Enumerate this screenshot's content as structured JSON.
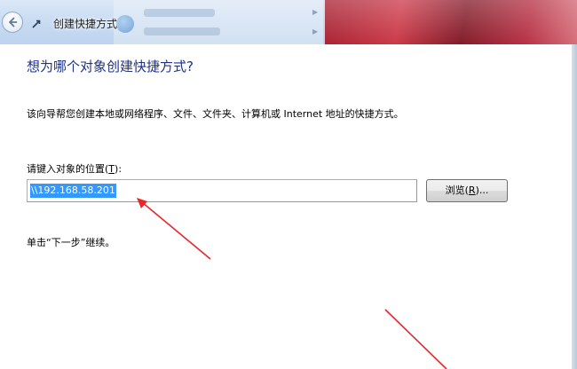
{
  "window": {
    "title": "创建快捷方式"
  },
  "wizard": {
    "heading": "想为哪个对象创建快捷方式?",
    "description": "该向导帮您创建本地或网络程序、文件、文件夹、计算机或 Internet 地址的快捷方式。",
    "location_label_prefix": "请键入对象的位置(",
    "location_label_accesskey": "T",
    "location_label_suffix": "):",
    "location_value": "\\\\192.168.58.201",
    "browse_label_prefix": "浏览(",
    "browse_label_accesskey": "R",
    "browse_label_suffix": ")...",
    "continue_text": "单击“下一步”继续。"
  },
  "icons": {
    "back": "back-arrow-icon",
    "app": "shortcut-icon"
  },
  "colors": {
    "heading": "#1e3287",
    "selection": "#3399ff",
    "annotation_arrow": "#e8262b",
    "titlebar": "#c6daf1"
  }
}
